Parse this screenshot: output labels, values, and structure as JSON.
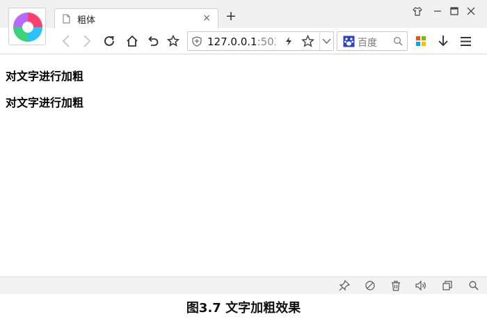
{
  "tab": {
    "title": "粗体"
  },
  "new_tab_label": "+",
  "close_tab_label": "×",
  "address_bar": {
    "url_main": "127.0.0.1",
    "url_suffix": ":502"
  },
  "search_box": {
    "placeholder": "百度",
    "engine_icon": "baidu-paw-icon"
  },
  "page": {
    "lines": [
      "对文字进行加粗",
      "对文字进行加粗"
    ]
  },
  "caption": "图3.7  文字加粗效果",
  "icons": {
    "toolbar": [
      "back-icon",
      "forward-icon",
      "reload-icon",
      "home-icon",
      "undo-icon",
      "bookmark-star-icon"
    ],
    "url": [
      "shield-icon",
      "lightning-icon",
      "star-icon",
      "dropdown-icon"
    ],
    "right": [
      "apps-grid-icon",
      "download-icon",
      "menu-icon"
    ],
    "window": [
      "skin-icon",
      "minimize-icon",
      "maximize-icon",
      "close-icon"
    ],
    "status": [
      "pin-icon",
      "no-image-icon",
      "trash-icon",
      "speaker-icon",
      "restore-icon",
      "zoom-icon"
    ]
  },
  "colors": {
    "chrome_bg": "#f0f0f0",
    "statusbar_bg": "#f2f2f2",
    "text": "#000000"
  }
}
